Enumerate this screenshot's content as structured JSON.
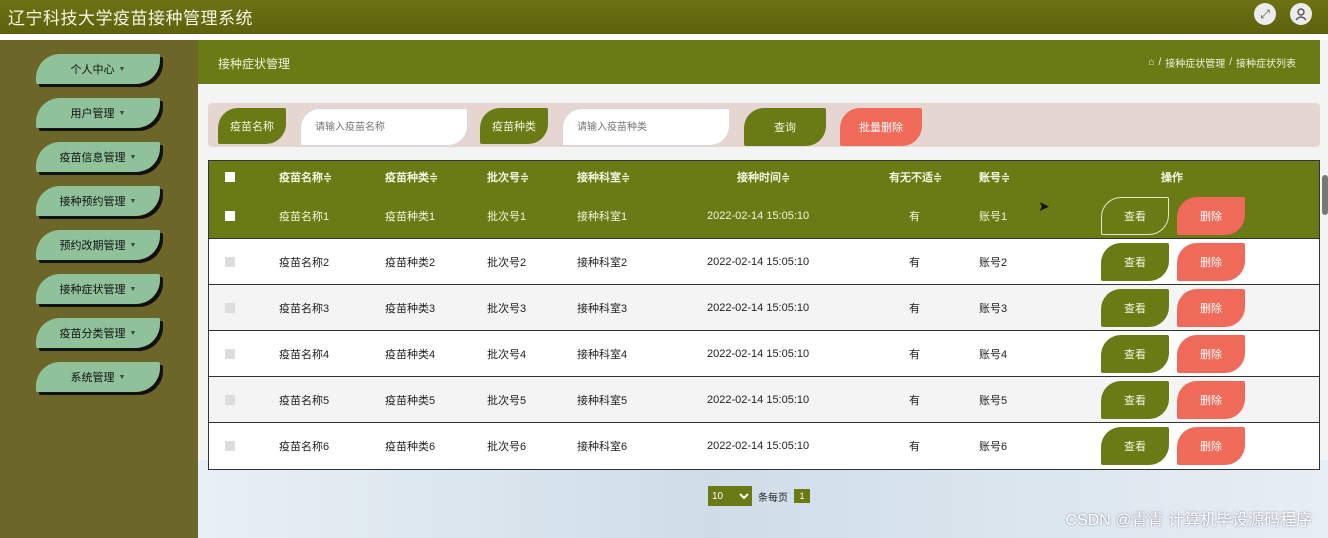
{
  "app": {
    "title": "辽宁科技大学疫苗接种管理系统"
  },
  "topbar": {
    "fullscreen_icon": "fullscreen-icon",
    "user_icon": "user-icon"
  },
  "sidebar": {
    "items": [
      {
        "label": "个人中心"
      },
      {
        "label": "用户管理"
      },
      {
        "label": "疫苗信息管理"
      },
      {
        "label": "接种预约管理"
      },
      {
        "label": "预约改期管理"
      },
      {
        "label": "接种症状管理"
      },
      {
        "label": "疫苗分类管理"
      },
      {
        "label": "系统管理"
      }
    ]
  },
  "header": {
    "page_title": "接种症状管理",
    "breadcrumb": {
      "home_icon": "home-icon",
      "sep": "/",
      "level1": "接种症状管理",
      "level2": "接种症状列表"
    }
  },
  "search": {
    "vaccine_name_label": "疫苗名称",
    "vaccine_name_placeholder": "请输入疫苗名称",
    "vaccine_type_label": "疫苗种类",
    "vaccine_type_placeholder": "请输入疫苗种类",
    "query_button": "查询",
    "batch_delete_button": "批量删除"
  },
  "table": {
    "columns": [
      "疫苗名称",
      "疫苗种类",
      "批次号",
      "接种科室",
      "接种时间",
      "有无不适",
      "账号",
      "操作"
    ],
    "sort_mark": "≑",
    "view_label": "查看",
    "delete_label": "删除",
    "rows": [
      {
        "name": "疫苗名称1",
        "type": "疫苗种类1",
        "batch": "批次号1",
        "dept": "接种科室1",
        "time": "2022-02-14 15:05:10",
        "discomfort": "有",
        "account": "账号1"
      },
      {
        "name": "疫苗名称2",
        "type": "疫苗种类2",
        "batch": "批次号2",
        "dept": "接种科室2",
        "time": "2022-02-14 15:05:10",
        "discomfort": "有",
        "account": "账号2"
      },
      {
        "name": "疫苗名称3",
        "type": "疫苗种类3",
        "batch": "批次号3",
        "dept": "接种科室3",
        "time": "2022-02-14 15:05:10",
        "discomfort": "有",
        "account": "账号3"
      },
      {
        "name": "疫苗名称4",
        "type": "疫苗种类4",
        "batch": "批次号4",
        "dept": "接种科室4",
        "time": "2022-02-14 15:05:10",
        "discomfort": "有",
        "account": "账号4"
      },
      {
        "name": "疫苗名称5",
        "type": "疫苗种类5",
        "batch": "批次号5",
        "dept": "接种科室5",
        "time": "2022-02-14 15:05:10",
        "discomfort": "有",
        "account": "账号5"
      },
      {
        "name": "疫苗名称6",
        "type": "疫苗种类6",
        "batch": "批次号6",
        "dept": "接种科室6",
        "time": "2022-02-14 15:05:10",
        "discomfort": "有",
        "account": "账号6"
      }
    ]
  },
  "pager": {
    "page_size": "10",
    "per_page_label": "条每页",
    "current_page": "1"
  },
  "watermark": "CSDN @青青  计算机毕设源码程序",
  "colors": {
    "primary": "#6a7a14",
    "danger": "#f06a5a",
    "sidebar": "#6d6629",
    "menu_button": "#8fc29a"
  }
}
